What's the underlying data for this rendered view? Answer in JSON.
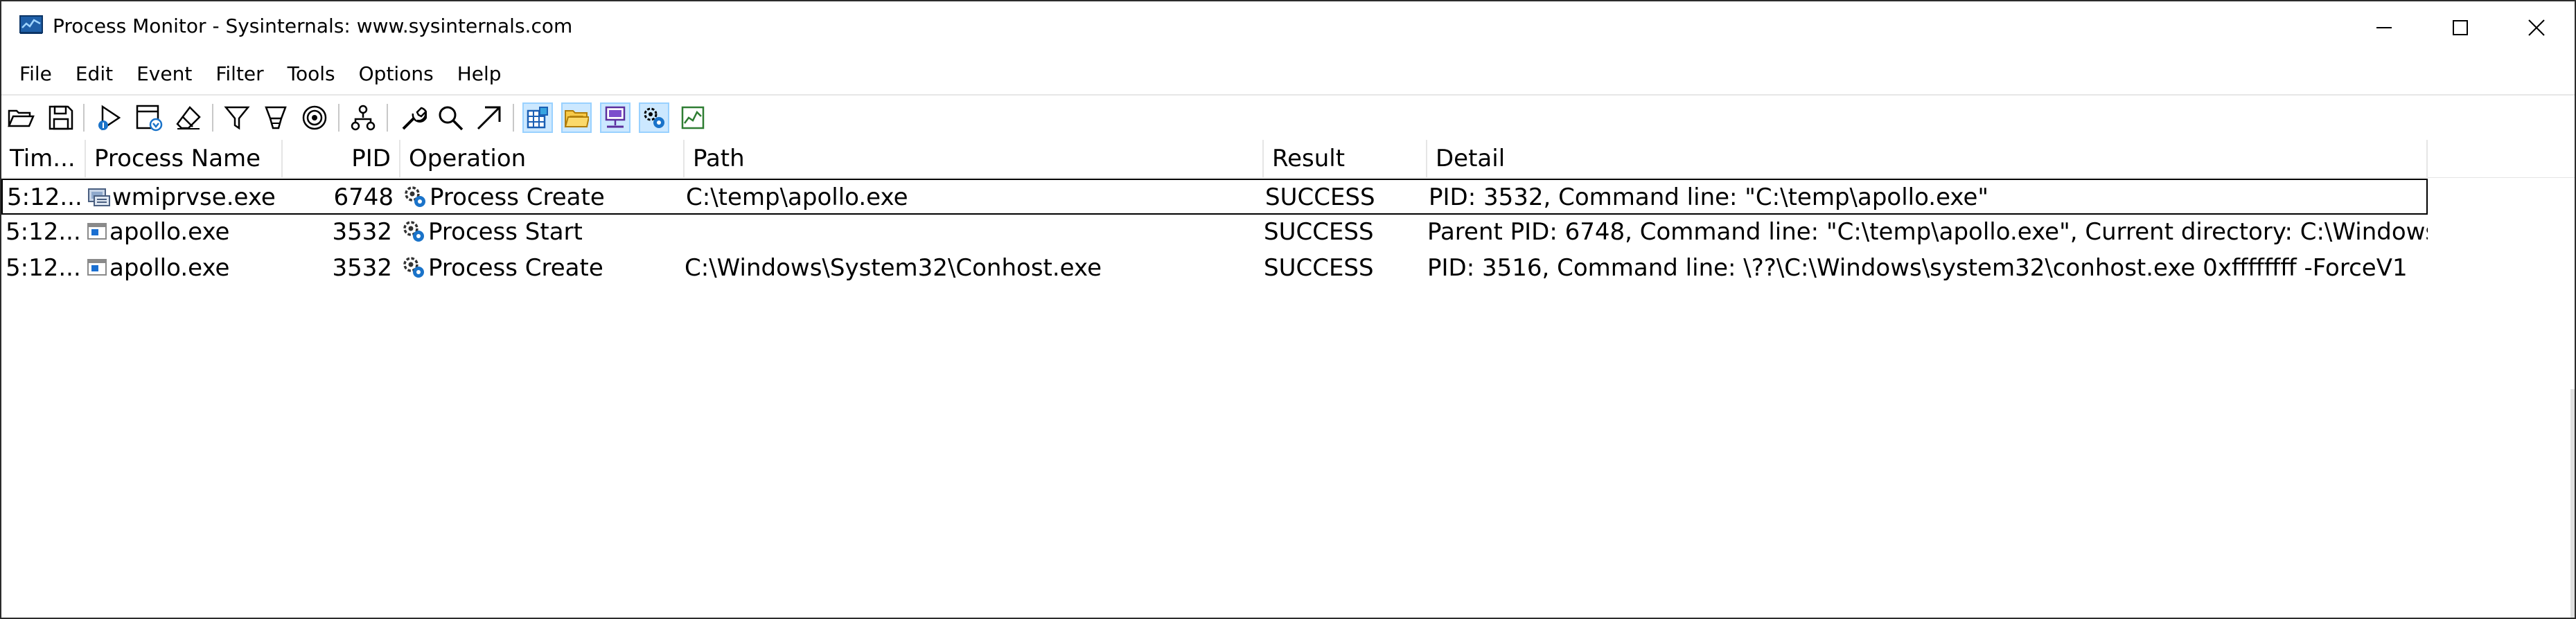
{
  "window": {
    "title": "Process Monitor - Sysinternals: www.sysinternals.com",
    "minimize_icon": "minimize-icon",
    "maximize_icon": "maximize-icon",
    "close_icon": "close-icon"
  },
  "menu": [
    "File",
    "Edit",
    "Event",
    "Filter",
    "Tools",
    "Options",
    "Help"
  ],
  "toolbar": {
    "icons": [
      "open-icon",
      "save-icon",
      "capture-icon",
      "autoscroll-icon",
      "clear-icon",
      "filter-icon",
      "highlight-icon",
      "include-process-icon",
      "process-tree-icon",
      "properties-icon",
      "find-icon",
      "jump-to-icon",
      "registry-activity-icon",
      "file-activity-icon",
      "network-activity-icon",
      "process-thread-activity-icon",
      "profiling-events-icon"
    ],
    "active": [
      "registry-activity-icon",
      "file-activity-icon",
      "network-activity-icon",
      "process-thread-activity-icon"
    ]
  },
  "columns": {
    "time": "Tim...",
    "process": "Process Name",
    "pid": "PID",
    "operation": "Operation",
    "path": "Path",
    "result": "Result",
    "detail": "Detail"
  },
  "rows": [
    {
      "time": "5:12...",
      "process": "wmiprvse.exe",
      "process_icon": "service-host-icon",
      "pid": "6748",
      "operation": "Process Create",
      "operation_icon": "process-gear-icon",
      "path": "C:\\temp\\apollo.exe",
      "result": "SUCCESS",
      "detail": "PID: 3532, Command line: \"C:\\temp\\apollo.exe\"",
      "selected": true
    },
    {
      "time": "5:12...",
      "process": "apollo.exe",
      "process_icon": "console-app-icon",
      "pid": "3532",
      "operation": "Process Start",
      "operation_icon": "process-gear-icon",
      "path": "",
      "result": "SUCCESS",
      "detail": "Parent PID: 6748, Command line: \"C:\\temp\\apollo.exe\", Current directory: C:\\Windows...",
      "selected": false
    },
    {
      "time": "5:12...",
      "process": "apollo.exe",
      "process_icon": "console-app-icon",
      "pid": "3532",
      "operation": "Process Create",
      "operation_icon": "process-gear-icon",
      "path": "C:\\Windows\\System32\\Conhost.exe",
      "result": "SUCCESS",
      "detail": "PID: 3516, Command line: \\??\\C:\\Windows\\system32\\conhost.exe 0xffffffff -ForceV1",
      "selected": false
    }
  ]
}
